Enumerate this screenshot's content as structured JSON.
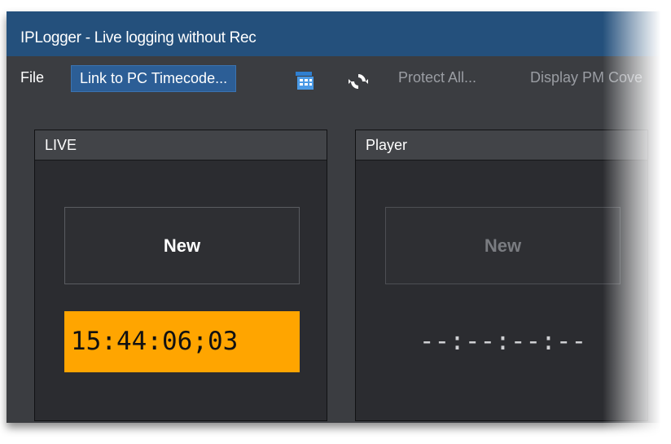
{
  "window": {
    "title": "IPLogger - Live logging without Rec"
  },
  "menu": {
    "file": "File",
    "link_button": "Link to PC Timecode...",
    "calendar_icon": "calendar-icon",
    "refresh_icon": "refresh-icon",
    "protect_all": "Protect All...",
    "display": "Display PM Cove"
  },
  "panels": {
    "live": {
      "title": "LIVE",
      "new_button": "New",
      "timecode": "15:44:06;03"
    },
    "player": {
      "title": "Player",
      "new_button": "New",
      "timecode": "--:--:--:--"
    }
  },
  "colors": {
    "titlebar": "#24507c",
    "accent_timecode": "#ffa500",
    "link_button": "#2c5e96",
    "background": "#3b3d41"
  }
}
